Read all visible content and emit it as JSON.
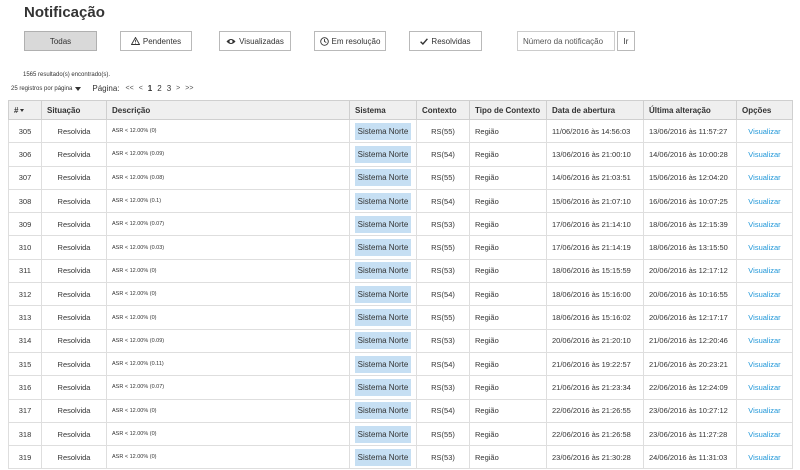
{
  "page": {
    "title": "Notificação"
  },
  "filters": {
    "buttons": [
      {
        "label": "Todas",
        "icon": "",
        "active": true
      },
      {
        "label": "Pendentes",
        "icon": "warning-icon",
        "active": false
      },
      {
        "label": "Visualizadas",
        "icon": "eye-icon",
        "active": false
      },
      {
        "label": "Em resolução",
        "icon": "clock-icon",
        "active": false
      },
      {
        "label": "Resolvidas",
        "icon": "check-icon",
        "active": false
      }
    ],
    "search_placeholder": "Número da notificação",
    "go_label": "Ir"
  },
  "results": {
    "count_text": "1565 resultado(s) encontrado(s)."
  },
  "pager": {
    "per_page": "25 registros por página",
    "label": "Página:",
    "first": "<<",
    "prev": "<",
    "pages": [
      "1",
      "2",
      "3"
    ],
    "current": "1",
    "next": ">",
    "last": ">>"
  },
  "table": {
    "headers": [
      "#",
      "Situação",
      "Descrição",
      "Sistema",
      "Contexto",
      "Tipo de Contexto",
      "Data de abertura",
      "Última alteração",
      "Opções"
    ],
    "rows": [
      {
        "id": "305",
        "status": "Resolvida",
        "desc": "ASR < 12.00% (0)",
        "system": "Sistema Norte",
        "context": "RS(55)",
        "ctx_type": "Região",
        "opened": "11/06/2016 às 14:56:03",
        "changed": "13/06/2016 às 11:57:27",
        "action": "Visualizar"
      },
      {
        "id": "306",
        "status": "Resolvida",
        "desc": "ASR < 12.00% (0.09)",
        "system": "Sistema Norte",
        "context": "RS(54)",
        "ctx_type": "Região",
        "opened": "13/06/2016 às 21:00:10",
        "changed": "14/06/2016 às 10:00:28",
        "action": "Visualizar"
      },
      {
        "id": "307",
        "status": "Resolvida",
        "desc": "ASR < 12.00% (0.08)",
        "system": "Sistema Norte",
        "context": "RS(55)",
        "ctx_type": "Região",
        "opened": "14/06/2016 às 21:03:51",
        "changed": "15/06/2016 às 12:04:20",
        "action": "Visualizar"
      },
      {
        "id": "308",
        "status": "Resolvida",
        "desc": "ASR < 12.00% (0.1)",
        "system": "Sistema Norte",
        "context": "RS(54)",
        "ctx_type": "Região",
        "opened": "15/06/2016 às 21:07:10",
        "changed": "16/06/2016 às 10:07:25",
        "action": "Visualizar"
      },
      {
        "id": "309",
        "status": "Resolvida",
        "desc": "ASR < 12.00% (0.07)",
        "system": "Sistema Norte",
        "context": "RS(53)",
        "ctx_type": "Região",
        "opened": "17/06/2016 às 21:14:10",
        "changed": "18/06/2016 às 12:15:39",
        "action": "Visualizar"
      },
      {
        "id": "310",
        "status": "Resolvida",
        "desc": "ASR < 12.00% (0.03)",
        "system": "Sistema Norte",
        "context": "RS(55)",
        "ctx_type": "Região",
        "opened": "17/06/2016 às 21:14:19",
        "changed": "18/06/2016 às 13:15:50",
        "action": "Visualizar"
      },
      {
        "id": "311",
        "status": "Resolvida",
        "desc": "ASR < 12.00% (0)",
        "system": "Sistema Norte",
        "context": "RS(53)",
        "ctx_type": "Região",
        "opened": "18/06/2016 às 15:15:59",
        "changed": "20/06/2016 às 12:17:12",
        "action": "Visualizar"
      },
      {
        "id": "312",
        "status": "Resolvida",
        "desc": "ASR < 12.00% (0)",
        "system": "Sistema Norte",
        "context": "RS(54)",
        "ctx_type": "Região",
        "opened": "18/06/2016 às 15:16:00",
        "changed": "20/06/2016 às 10:16:55",
        "action": "Visualizar"
      },
      {
        "id": "313",
        "status": "Resolvida",
        "desc": "ASR < 12.00% (0)",
        "system": "Sistema Norte",
        "context": "RS(55)",
        "ctx_type": "Região",
        "opened": "18/06/2016 às 15:16:02",
        "changed": "20/06/2016 às 12:17:17",
        "action": "Visualizar"
      },
      {
        "id": "314",
        "status": "Resolvida",
        "desc": "ASR < 12.00% (0.09)",
        "system": "Sistema Norte",
        "context": "RS(53)",
        "ctx_type": "Região",
        "opened": "20/06/2016 às 21:20:10",
        "changed": "21/06/2016 às 12:20:46",
        "action": "Visualizar"
      },
      {
        "id": "315",
        "status": "Resolvida",
        "desc": "ASR < 12.00% (0.11)",
        "system": "Sistema Norte",
        "context": "RS(54)",
        "ctx_type": "Região",
        "opened": "21/06/2016 às 19:22:57",
        "changed": "21/06/2016 às 20:23:21",
        "action": "Visualizar"
      },
      {
        "id": "316",
        "status": "Resolvida",
        "desc": "ASR < 12.00% (0.07)",
        "system": "Sistema Norte",
        "context": "RS(53)",
        "ctx_type": "Região",
        "opened": "21/06/2016 às 21:23:34",
        "changed": "22/06/2016 às 12:24:09",
        "action": "Visualizar"
      },
      {
        "id": "317",
        "status": "Resolvida",
        "desc": "ASR < 12.00% (0)",
        "system": "Sistema Norte",
        "context": "RS(54)",
        "ctx_type": "Região",
        "opened": "22/06/2016 às 21:26:55",
        "changed": "23/06/2016 às 10:27:12",
        "action": "Visualizar"
      },
      {
        "id": "318",
        "status": "Resolvida",
        "desc": "ASR < 12.00% (0)",
        "system": "Sistema Norte",
        "context": "RS(55)",
        "ctx_type": "Região",
        "opened": "22/06/2016 às 21:26:58",
        "changed": "23/06/2016 às 11:27:28",
        "action": "Visualizar"
      },
      {
        "id": "319",
        "status": "Resolvida",
        "desc": "ASR < 12.00% (0)",
        "system": "Sistema Norte",
        "context": "RS(53)",
        "ctx_type": "Região",
        "opened": "23/06/2016 às 21:30:28",
        "changed": "24/06/2016 às 11:31:03",
        "action": "Visualizar"
      }
    ]
  },
  "colors": {
    "system_badge_bg": "#c6dff3",
    "link": "#1e96d8",
    "header_bg": "#efefef",
    "active_filter_bg": "#d9d9d9"
  }
}
